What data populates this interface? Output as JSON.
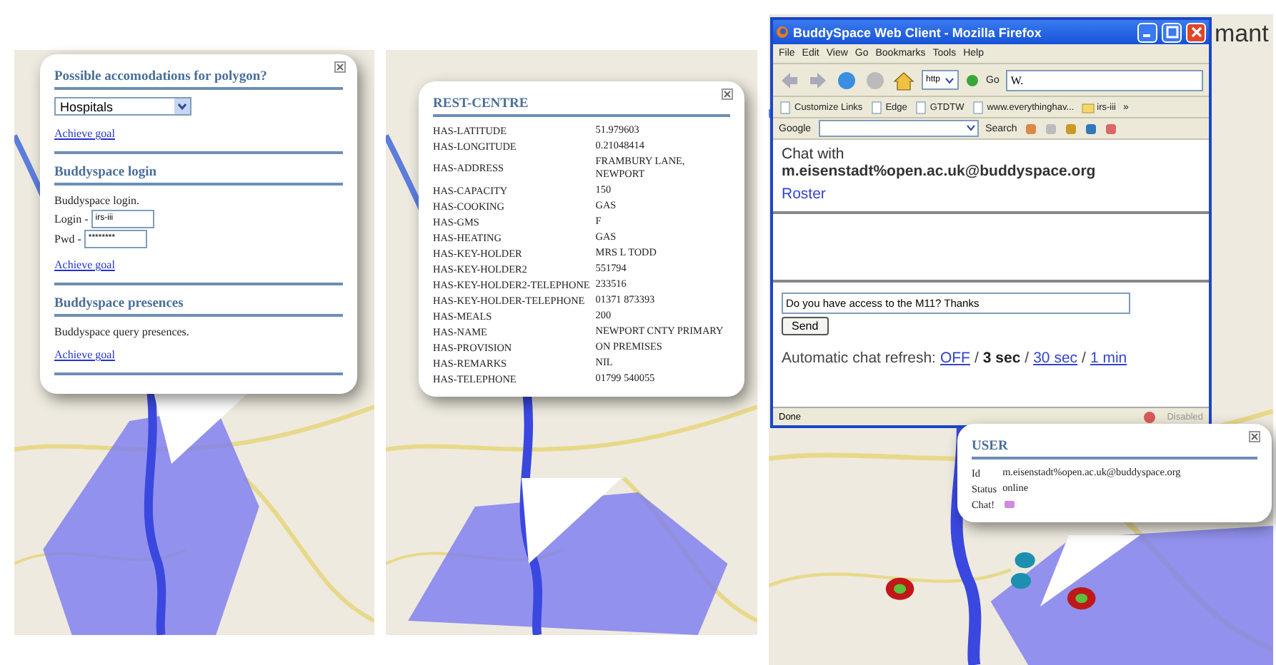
{
  "goals_popup": {
    "sections": [
      {
        "kind": "select",
        "heading": "Possible accomodations for polygon?",
        "value": "Hospitals",
        "link": "Achieve goal"
      },
      {
        "kind": "login",
        "heading": "Buddyspace login",
        "intro": "Buddyspace login.",
        "fields": [
          {
            "label": "Login -",
            "value": "irs-iii"
          },
          {
            "label": "Pwd -",
            "value": "********"
          }
        ],
        "link": "Achieve goal"
      },
      {
        "kind": "text",
        "heading": "Buddyspace presences",
        "intro": "Buddyspace query presences.",
        "link": "Achieve goal"
      }
    ]
  },
  "rest_centre_popup": {
    "title": "REST-CENTRE",
    "rows": [
      {
        "key": "HAS-LATITUDE",
        "value": "51.979603"
      },
      {
        "key": "HAS-LONGITUDE",
        "value": "0.21048414"
      },
      {
        "key": "HAS-ADDRESS",
        "value": "FRAMBURY LANE, NEWPORT"
      },
      {
        "key": "HAS-CAPACITY",
        "value": "150"
      },
      {
        "key": "HAS-COOKING",
        "value": "GAS"
      },
      {
        "key": "HAS-GMS",
        "value": "F"
      },
      {
        "key": "HAS-HEATING",
        "value": "GAS"
      },
      {
        "key": "HAS-KEY-HOLDER",
        "value": "MRS L TODD"
      },
      {
        "key": "HAS-KEY-HOLDER2",
        "value": "551794"
      },
      {
        "key": "HAS-KEY-HOLDER2-TELEPHONE",
        "value": "233516"
      },
      {
        "key": "HAS-KEY-HOLDER-TELEPHONE",
        "value": "01371 873393"
      },
      {
        "key": "HAS-MEALS",
        "value": "200"
      },
      {
        "key": "HAS-NAME",
        "value": "NEWPORT CNTY PRIMARY"
      },
      {
        "key": "HAS-PROVISION",
        "value": "ON PREMISES"
      },
      {
        "key": "HAS-REMARKS",
        "value": "NIL"
      },
      {
        "key": "HAS-TELEPHONE",
        "value": "01799 540055"
      }
    ]
  },
  "page_heading_fragment": "mant",
  "browser": {
    "title": "BuddySpace Web Client - Mozilla Firefox",
    "menu": [
      "File",
      "Edit",
      "View",
      "Go",
      "Bookmarks",
      "Tools",
      "Help"
    ],
    "address_value": "http",
    "go_label": "Go",
    "search_value": "W.",
    "bookmarks": [
      {
        "kind": "page",
        "label": "Customize Links"
      },
      {
        "kind": "page",
        "label": "Edge"
      },
      {
        "kind": "page",
        "label": "GTDTW"
      },
      {
        "kind": "page",
        "label": "www.everythinghav..."
      },
      {
        "kind": "folder",
        "label": "irs-iii"
      }
    ],
    "overflow": "»",
    "google_label": "Google",
    "google_search": "Search",
    "chat_with": "Chat with",
    "contact": "m.eisenstadt%open.ac.uk@buddyspace.org",
    "roster": "Roster",
    "message": "Do you have access to the M11? Thanks",
    "send": "Send",
    "refresh_label": "Automatic chat refresh:",
    "refresh_separator": "/",
    "refresh_options": [
      {
        "label": "OFF",
        "selected": false
      },
      {
        "label": "3 sec",
        "selected": true
      },
      {
        "label": "30 sec",
        "selected": false
      },
      {
        "label": "1 min",
        "selected": false
      }
    ],
    "status": "Done",
    "status_right": "Disabled"
  },
  "user_popup": {
    "title": "USER",
    "rows": [
      {
        "kind": "text",
        "label": "Id",
        "value": "m.eisenstadt%open.ac.uk@buddyspace.org"
      },
      {
        "kind": "text",
        "label": "Status",
        "value": "online"
      },
      {
        "kind": "icon",
        "label": "Chat!"
      }
    ]
  }
}
